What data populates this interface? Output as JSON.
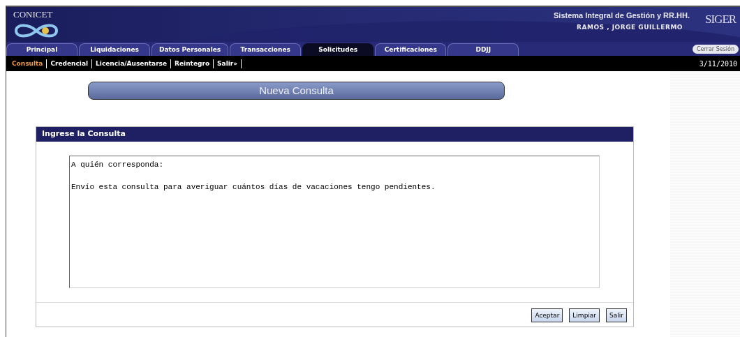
{
  "header": {
    "org": "CONICET",
    "system": "Sistema Integral de Gestión y RR.HH.",
    "user": "RAMOS , JORGE GUILLERMO",
    "logo": "SIGER"
  },
  "tabs": [
    {
      "label": "Principal",
      "selected": false
    },
    {
      "label": "Liquidaciones",
      "selected": false
    },
    {
      "label": "Datos Personales",
      "selected": false
    },
    {
      "label": "Transacciones",
      "selected": false
    },
    {
      "label": "Solicitudes",
      "selected": true
    },
    {
      "label": "Certificaciones",
      "selected": false
    },
    {
      "label": "DDJJ",
      "selected": false
    }
  ],
  "logout": "Cerrar Sesión",
  "subnav": [
    {
      "label": "Consulta",
      "selected": true
    },
    {
      "label": "Credencial",
      "selected": false
    },
    {
      "label": "Licencia/Ausentarse",
      "selected": false
    },
    {
      "label": "Reintegro",
      "selected": false
    },
    {
      "label": "Salir»",
      "selected": false
    }
  ],
  "date": "3/11/2010",
  "page_title": "Nueva Consulta",
  "panel": {
    "title": "Ingrese la Consulta",
    "value": "A quién corresponda:\n\nEnvío esta consulta para averiguar cuántos días de vacaciones tengo pendientes.",
    "buttons": [
      "Aceptar",
      "Limpiar",
      "Salir"
    ]
  }
}
